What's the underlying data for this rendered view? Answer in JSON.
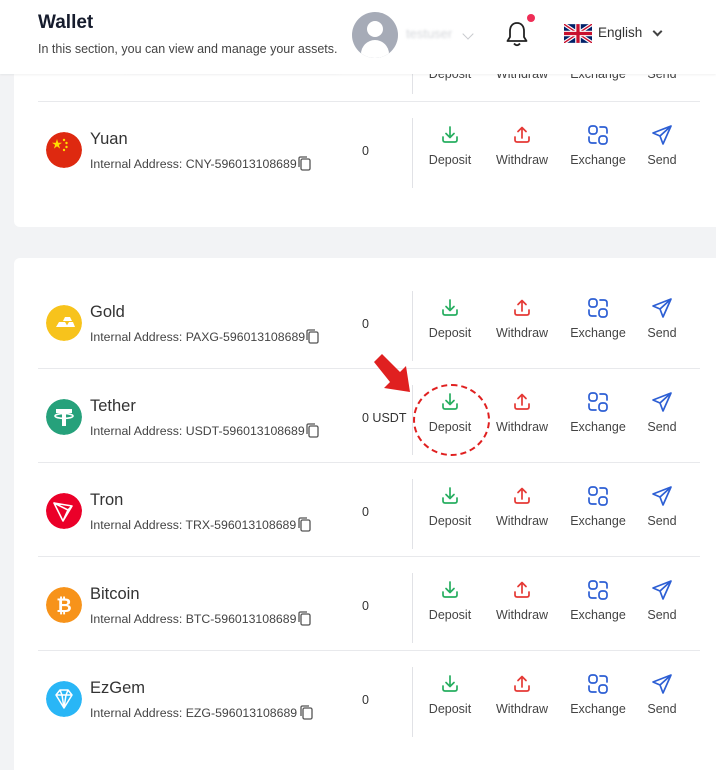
{
  "header": {
    "title": "Wallet",
    "subtitle": "In this section, you can view and manage your assets.",
    "username": "testuser",
    "language": "English"
  },
  "actions": {
    "deposit": "Deposit",
    "withdraw": "Withdraw",
    "exchange": "Exchange",
    "send": "Send"
  },
  "colors": {
    "deposit": "#27ae60",
    "withdraw": "#e53935",
    "exchange": "#2d5fd4",
    "send": "#2d5fd4",
    "notification_dot": "#ef2d56",
    "highlight": "#e02020"
  },
  "card1": {
    "coins": [
      {
        "name": "Yuan",
        "address": "Internal Address: CNY-596013108689",
        "balance": "0",
        "icon": "china-flag-icon"
      }
    ]
  },
  "card2": {
    "coins": [
      {
        "name": "Gold",
        "address": "Internal Address: PAXG-596013108689",
        "balance": "0",
        "icon": "gold-bars-icon"
      },
      {
        "name": "Tether",
        "address": "Internal Address: USDT-596013108689",
        "balance": "0 USDT",
        "icon": "tether-icon"
      },
      {
        "name": "Tron",
        "address": "Internal Address: TRX-596013108689",
        "balance": "0",
        "icon": "tron-icon"
      },
      {
        "name": "Bitcoin",
        "address": "Internal Address: BTC-596013108689",
        "balance": "0",
        "icon": "bitcoin-icon"
      },
      {
        "name": "EzGem",
        "address": "Internal Address: EZG-596013108689",
        "balance": "0",
        "icon": "diamond-icon"
      }
    ]
  }
}
